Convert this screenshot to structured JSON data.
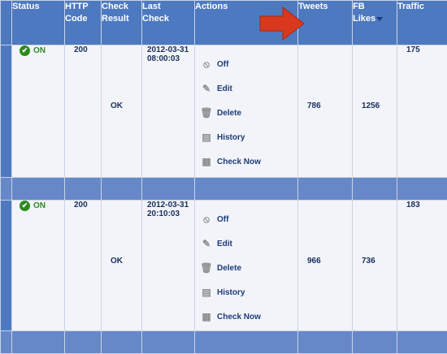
{
  "headers": {
    "status": "Status",
    "http_code": [
      "HTTP",
      "Code"
    ],
    "check_result": [
      "Check",
      "Result"
    ],
    "last_check": [
      "Last",
      "Check"
    ],
    "actions": "Actions",
    "tweets": "Tweets",
    "fb_likes": [
      "FB",
      "Likes"
    ],
    "traffic": "Traffic"
  },
  "rows": [
    {
      "status": "ON",
      "http_code": "200",
      "check_result": "OK",
      "last_check": [
        "2012-03-31",
        "08:00:03"
      ],
      "tweets": "786",
      "fb_likes": "1256",
      "traffic": "175",
      "actions": {
        "off": "Off",
        "edit": "Edit",
        "delete": "Delete",
        "history": "History",
        "check_now": "Check Now"
      }
    },
    {
      "status": "ON",
      "http_code": "200",
      "check_result": "OK",
      "last_check": [
        "2012-03-31",
        "20:10:03"
      ],
      "tweets": "966",
      "fb_likes": "736",
      "traffic": "183",
      "actions": {
        "off": "Off",
        "edit": "Edit",
        "delete": "Delete",
        "history": "History",
        "check_now": "Check Now"
      }
    }
  ],
  "colors": {
    "header_bg": "#4d79c0",
    "separator_bg": "#6688c9",
    "status_on": "#2e8a1e",
    "arrow": "#d8391e"
  },
  "sorted_column": "fb_likes"
}
